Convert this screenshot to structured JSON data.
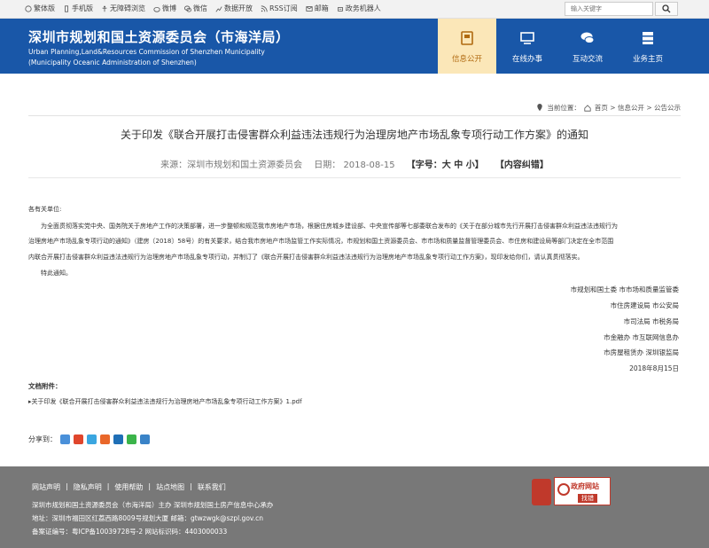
{
  "topbar": {
    "links": [
      "繁体版",
      "手机版",
      "无障碍浏览",
      "微博",
      "微信",
      "数据开放",
      "RSS订阅",
      "邮箱",
      "政务机器人"
    ],
    "search_placeholder": "输入关键字"
  },
  "header": {
    "title": "深圳市规划和国土资源委员会（市海洋局）",
    "en_line1": "Urban Planning,Land&Resources Commission of Shenzhen Municipality",
    "en_line2": "(Municipality Oceanic Administration of Shenzhen)",
    "nav": [
      "信息公开",
      "在线办事",
      "互动交流",
      "业务主页"
    ]
  },
  "breadcrumb": {
    "prefix": "当前位置：",
    "path": "首页 > 信息公开 > 公告公示"
  },
  "article": {
    "title": "关于印发《联合开展打击侵害群众利益违法违规行为治理房地产市场乱象专项行动工作方案》的通知",
    "source": "来源：深圳市规划和国土资源委员会",
    "date": "日期：  2018-08-15",
    "font_size": "【字号：大 中 小】",
    "correction": "【内容纠错】",
    "salutation": "各有关单位:",
    "paragraphs": [
      "为全面贯彻落实党中央、国务院关于房地产工作的决策部署，进一步整顿和规范我市房地产市场，根据住房城乡建设部、中央宣传部等七部委联合发布的《关于在部分城市先行开展打击侵害群众利益违法违规行为",
      "治理房地产市场乱象专项行动的通知》（建房〔2018〕58号）的有关要求，结合我市房地产市场监管工作实际情况，市规划和国土资源委员会、市市场和质量监督管理委员会、市住房和建设局等部门决定在全市范围",
      "内联合开展打击侵害群众利益违法违规行为治理房地产市场乱象专项行动，并制订了《联合开展打击侵害群众利益违法违规行为治理房地产市场乱象专项行动工作方案》，现印发给你们，请认真贯彻落实。",
      "特此通知。"
    ],
    "signatures": [
      "市规划和国土委 市市场和质量监管委",
      "市住房建设局 市公安局",
      "市司法局 市税务局",
      "市金融办 市互联网信息办",
      "市房屋租赁办 深圳银监局",
      "2018年8月15日"
    ],
    "attachment_label": "文档附件：",
    "attachment_link": "关于印发《联合开展打击侵害群众利益违法违规行为治理房地产市场乱象专项行动工作方案》1.pdf",
    "share_label": "分享到："
  },
  "footer": {
    "links": [
      "网站声明",
      "隐私声明",
      "使用帮助",
      "站点地图",
      "联系我们"
    ],
    "sponsor": "深圳市规划和国土资源委员会（市海洋局）主办    深圳市规划国土房产信息中心承办",
    "address": "地址：深圳市福田区红荔西路8009号规划大厦    邮箱：gtwzwgk@szpl.gov.cn",
    "icp": "备案证编号：粤ICP备10039728号-2 网站标识码：4403000033",
    "gov_badge_line1": "政府网站",
    "gov_badge_line2": "找错"
  },
  "colors": {
    "header_blue": "#1957a8",
    "nav_active_bg": "#fbe7b8",
    "footer_gray": "#787878"
  }
}
